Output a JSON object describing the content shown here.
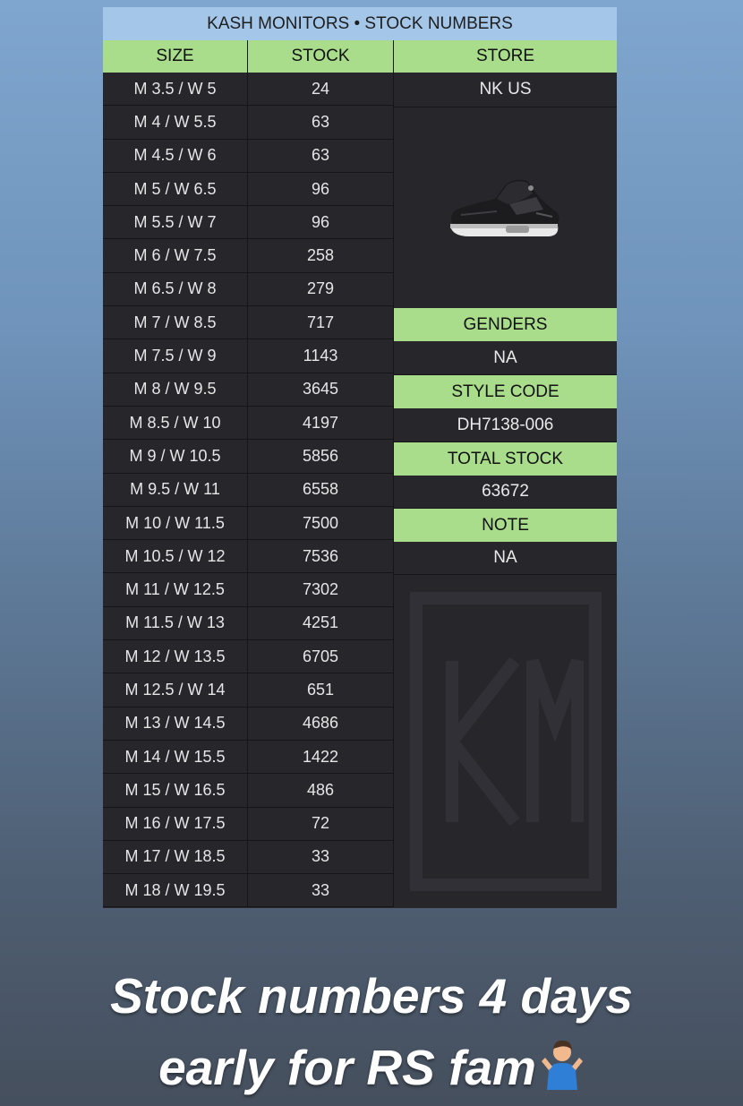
{
  "sheet": {
    "title": "KASH MONITORS • STOCK NUMBERS",
    "headers": {
      "size": "SIZE",
      "stock": "STOCK",
      "store": "STORE"
    },
    "rows": [
      {
        "size": "M 3.5 / W 5",
        "stock": "24"
      },
      {
        "size": "M 4 / W 5.5",
        "stock": "63"
      },
      {
        "size": "M 4.5 / W 6",
        "stock": "63"
      },
      {
        "size": "M 5 / W 6.5",
        "stock": "96"
      },
      {
        "size": "M 5.5 / W 7",
        "stock": "96"
      },
      {
        "size": "M 6 / W 7.5",
        "stock": "258"
      },
      {
        "size": "M 6.5 / W 8",
        "stock": "279"
      },
      {
        "size": "M 7 / W 8.5",
        "stock": "717"
      },
      {
        "size": "M 7.5 / W 9",
        "stock": "1143"
      },
      {
        "size": "M 8 / W 9.5",
        "stock": "3645"
      },
      {
        "size": "M 8.5 / W 10",
        "stock": "4197"
      },
      {
        "size": "M 9 / W 10.5",
        "stock": "5856"
      },
      {
        "size": "M 9.5 / W 11",
        "stock": "6558"
      },
      {
        "size": "M 10 / W 11.5",
        "stock": "7500"
      },
      {
        "size": "M 10.5 / W 12",
        "stock": "7536"
      },
      {
        "size": "M 11 / W 12.5",
        "stock": "7302"
      },
      {
        "size": "M 11.5 / W 13",
        "stock": "4251"
      },
      {
        "size": "M 12 / W 13.5",
        "stock": "6705"
      },
      {
        "size": "M 12.5 / W 14",
        "stock": "651"
      },
      {
        "size": "M 13 / W 14.5",
        "stock": "4686"
      },
      {
        "size": "M 14 / W 15.5",
        "stock": "1422"
      },
      {
        "size": "M 15 / W 16.5",
        "stock": "486"
      },
      {
        "size": "M 16 / W 17.5",
        "stock": "72"
      },
      {
        "size": "M 17 / W 18.5",
        "stock": "33"
      },
      {
        "size": "M 18 / W 19.5",
        "stock": "33"
      }
    ],
    "side": {
      "store_value": "NK US",
      "genders_label": "GENDERS",
      "genders_value": "NA",
      "style_code_label": "STYLE CODE",
      "style_code_value": "DH7138-006",
      "total_stock_label": "TOTAL STOCK",
      "total_stock_value": "63672",
      "note_label": "NOTE",
      "note_value": "NA"
    },
    "product_image": "sneaker-image",
    "watermark": "KM"
  },
  "caption": {
    "line1": "Stock numbers 4 days",
    "line2": "early for RS fam",
    "emoji": "person-shrugging-emoji"
  },
  "colors": {
    "title_bar": "#a4c6e8",
    "header_green": "#a9dc8b",
    "sheet_bg": "#27272b"
  }
}
